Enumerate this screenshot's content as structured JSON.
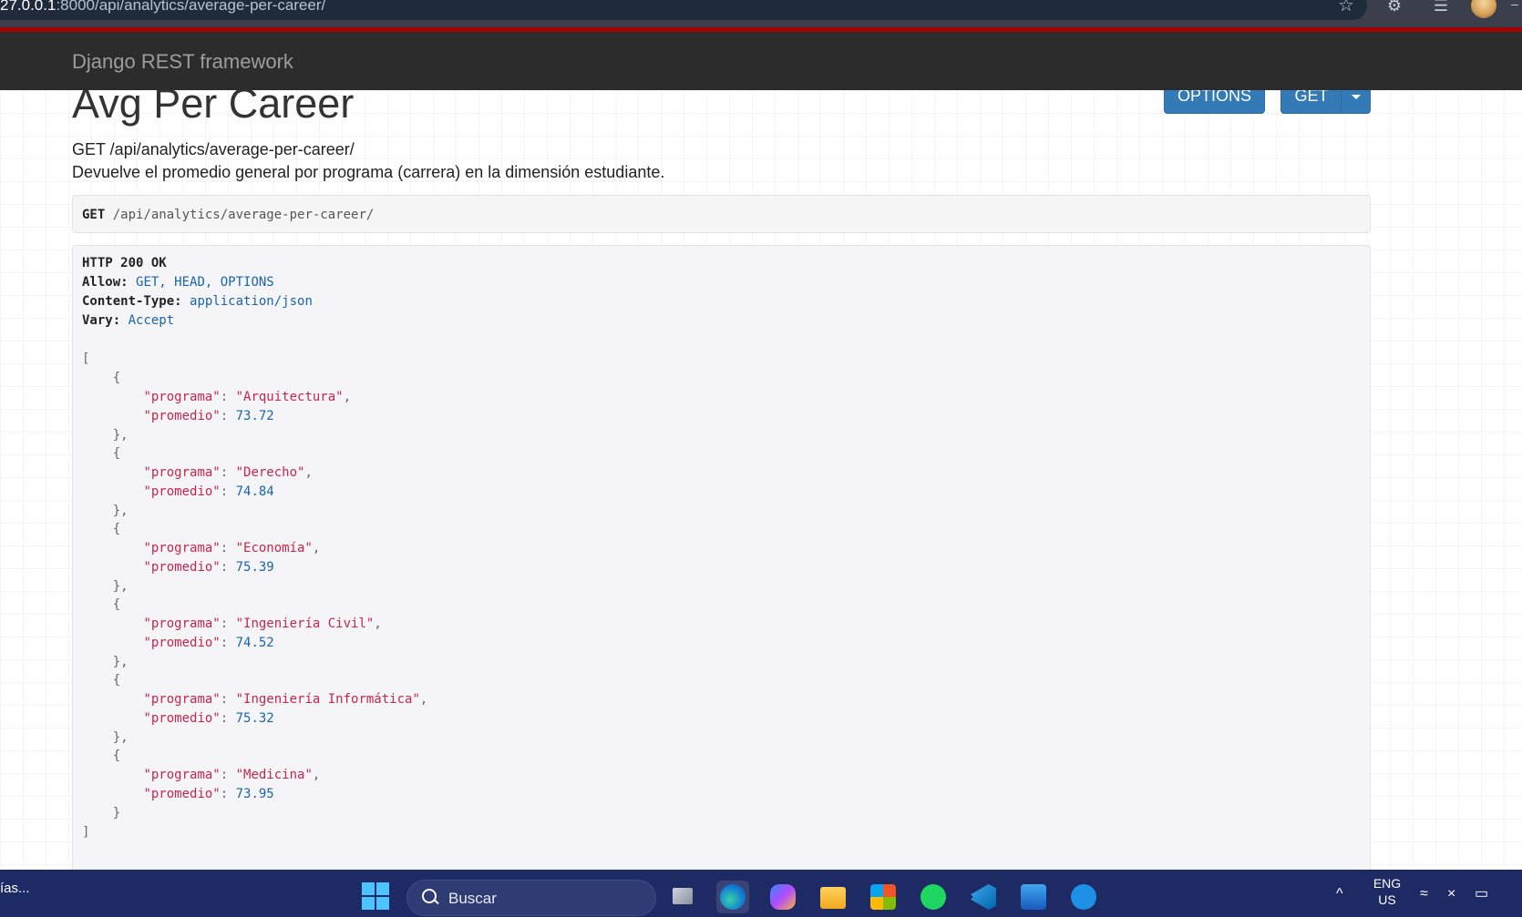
{
  "browser": {
    "address_host": "27.0.0.1",
    "address_path": ":8000/api/analytics/average-per-career/",
    "icons": [
      "star-icon",
      "extensions-icon",
      "reading-list-icon",
      "profile-avatar"
    ]
  },
  "navbar": {
    "brand": "Django REST framework",
    "accent_color": "#a30000",
    "background": "#2c2c2c"
  },
  "page": {
    "title": "Avg Per Career",
    "buttons": {
      "options": "OPTIONS",
      "get": "GET"
    },
    "request_line": "GET /api/analytics/average-per-career/",
    "description": "Devuelve el promedio general por programa (carrera) en la dimensión estudiante."
  },
  "request": {
    "method": "GET",
    "path": "/api/analytics/average-per-career/"
  },
  "response": {
    "status": "HTTP 200 OK",
    "headers": [
      {
        "name": "Allow:",
        "value": "GET, HEAD, OPTIONS"
      },
      {
        "name": "Content-Type:",
        "value": "application/json"
      },
      {
        "name": "Vary:",
        "value": "Accept"
      }
    ],
    "key_programa": "\"programa\"",
    "key_promedio": "\"promedio\"",
    "items": [
      {
        "programa": "\"Arquitectura\"",
        "promedio": "73.72"
      },
      {
        "programa": "\"Derecho\"",
        "promedio": "74.84"
      },
      {
        "programa": "\"Economía\"",
        "promedio": "75.39"
      },
      {
        "programa": "\"Ingeniería Civil\"",
        "promedio": "74.52"
      },
      {
        "programa": "\"Ingeniería Informática\"",
        "promedio": "75.32"
      },
      {
        "programa": "\"Medicina\"",
        "promedio": "73.95"
      }
    ]
  },
  "taskbar": {
    "left_text": "ías...",
    "search_placeholder": "Buscar",
    "language_line1": "ENG",
    "language_line2": "US",
    "apps": [
      "task-view",
      "edge",
      "copilot",
      "file-explorer",
      "microsoft-store",
      "spotify",
      "vscode",
      "word",
      "docker"
    ]
  }
}
